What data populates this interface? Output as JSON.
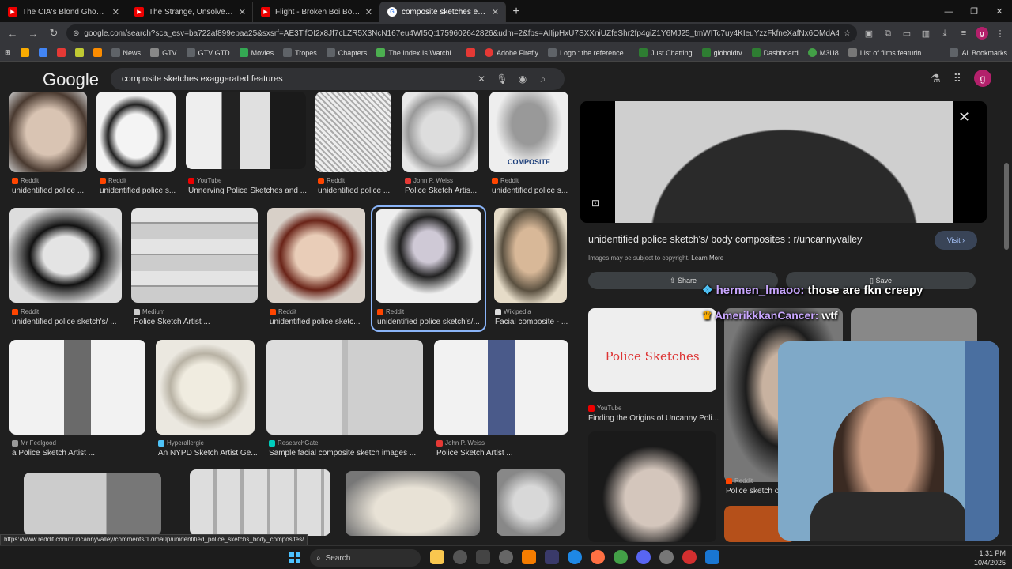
{
  "browser": {
    "tabs": [
      {
        "title": "The CIA's Blond Ghost: Ted Sha",
        "icon": "youtube-icon"
      },
      {
        "title": "The Strange, Unsolved Death of",
        "icon": "youtube-icon"
      },
      {
        "title": "Flight - Broken Boi Boi (Official",
        "icon": "youtube-icon"
      },
      {
        "title": "composite sketches exaggerate",
        "icon": "google-icon"
      }
    ],
    "new_tab": "+",
    "url": "google.com/search?sca_esv=ba722af899ebaa25&sxsrf=AE3TifOI2x8Jf7cLZR5X3NcN167eu4WI5Q:1759602642826&udm=2&fbs=AIIjpHxU7SXXniUZfeShr2fp4giZ1Y6MJ25_tmWITc7uy4KIeuYzzFkfneXafNx6OMdA4MQRuc_t_TQjwHY...",
    "profile_initial": "g",
    "bookmarks": [
      {
        "label": "News",
        "color": "#5f6368"
      },
      {
        "label": "GTV",
        "color": "#888"
      },
      {
        "label": "GTV GTD",
        "color": "#5f6368"
      },
      {
        "label": "Movies",
        "color": "#34a853"
      },
      {
        "label": "Tropes",
        "color": "#5f6368"
      },
      {
        "label": "Chapters",
        "color": "#5f6368"
      },
      {
        "label": "The Index Is Watchi...",
        "color": "#4caf50"
      },
      {
        "label": "Adobe Firefly",
        "color": "#e53935"
      },
      {
        "label": "Logo : the reference...",
        "color": "#5f6368"
      },
      {
        "label": "Just Chatting",
        "color": "#2e7d32"
      },
      {
        "label": "globoidtv",
        "color": "#2e7d32"
      },
      {
        "label": "Dashboard",
        "color": "#2e7d32"
      },
      {
        "label": "M3U8",
        "color": "#43a047"
      },
      {
        "label": "List of films featurin...",
        "color": "#777"
      }
    ],
    "all_bookmarks": "All Bookmarks"
  },
  "google": {
    "logo": "Google",
    "query": "composite sketches exaggerated features"
  },
  "results": {
    "row1": [
      {
        "source": "Reddit",
        "title": "unidentified police ..."
      },
      {
        "source": "Reddit",
        "title": "unidentified police s..."
      },
      {
        "source": "YouTube",
        "title": "Unnerving Police Sketches and ..."
      },
      {
        "source": "Reddit",
        "title": "unidentified police ..."
      },
      {
        "source": "John P. Weiss",
        "title": "Police Sketch Artis..."
      },
      {
        "source": "Reddit",
        "title": "unidentified police s..."
      }
    ],
    "composite_label": "COMPOSITE",
    "row2": [
      {
        "source": "Reddit",
        "title": "unidentified police sketch's/ ..."
      },
      {
        "source": "Medium",
        "title": "Police Sketch Artist ..."
      },
      {
        "source": "Reddit",
        "title": "unidentified police sketc..."
      },
      {
        "source": "Reddit",
        "title": "unidentified police sketch's/..."
      },
      {
        "source": "Wikipedia",
        "title": "Facial composite - ..."
      }
    ],
    "row3": [
      {
        "source": "Mr Feelgood",
        "title": "a Police Sketch Artist ..."
      },
      {
        "source": "Hyperallergic",
        "title": "An NYPD Sketch Artist Ge..."
      },
      {
        "source": "ResearchGate",
        "title": "Sample facial composite sketch images ..."
      },
      {
        "source": "John P. Weiss",
        "title": "Police Sketch Artist ..."
      }
    ]
  },
  "panel": {
    "title": "unidentified police sketch's/ body composites : r/uncannyvalley",
    "visit": "Visit",
    "copyright": "Images may be subject to copyright.",
    "learn_more": "Learn More",
    "share": "Share",
    "save": "Save",
    "related": [
      {
        "source": "YouTube",
        "title": "Finding the Origins of Uncanny Poli..."
      },
      {
        "source": "Reddit",
        "title": "Police sketch of ur"
      }
    ],
    "related_text": "Police Sketches"
  },
  "overlay": {
    "chat": [
      {
        "user": "hermen_lmaoo:",
        "message": "those are fkn creepy"
      },
      {
        "user": "AmerikkkanCancer:",
        "message": "wtf"
      }
    ]
  },
  "status_url": "https://www.reddit.com/r/uncannyvalley/comments/17ima0p/unidentified_police_sketchs_body_composites/",
  "taskbar": {
    "search": "Search",
    "time": "1:31 PM",
    "date": "10/4/2025"
  }
}
